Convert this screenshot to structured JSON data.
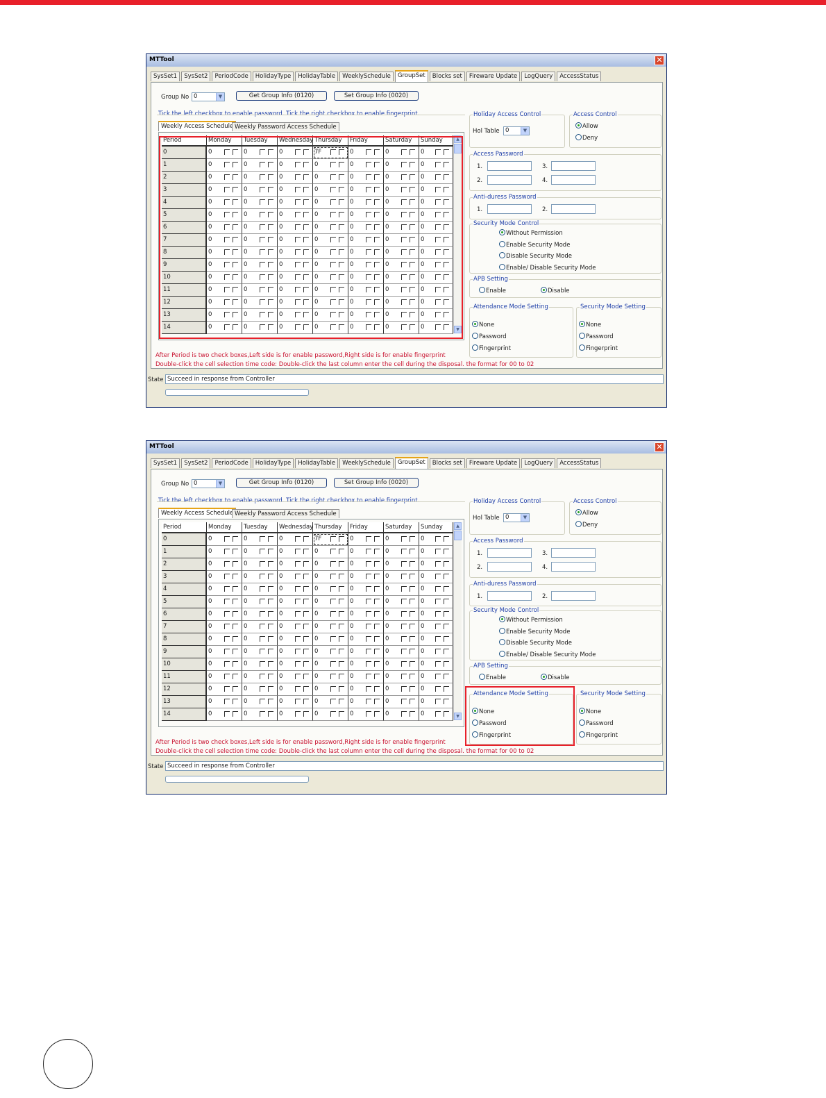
{
  "window": {
    "title": "MTTool",
    "close_label": "✕",
    "tabs": [
      "SysSet1",
      "SysSet2",
      "PeriodCode",
      "HolidayType",
      "HolidayTable",
      "WeeklySchedule",
      "GroupSet",
      "Blocks set",
      "Fireware Update",
      "LogQuery",
      "AccessStatus"
    ],
    "active_tab": 6
  },
  "group": {
    "label": "Group No",
    "value": "0",
    "get_button": "Get Group Info (0120)",
    "set_button": "Set Group Info (0020)"
  },
  "hint_top": "Tick the left checkbox to enable password. Tick the right checkbox to enable fingerprint.",
  "schedule_tabs": [
    "Weekly Access Schedule",
    "Weekly Password Access Schedule"
  ],
  "grid": {
    "columns": [
      "Period",
      "Monday",
      "Tuesday",
      "Wednesday",
      "Thursday",
      "Friday",
      "Saturday",
      "Sunday"
    ],
    "periods": [
      "0",
      "1",
      "2",
      "3",
      "4",
      "5",
      "6",
      "7",
      "8",
      "9",
      "10",
      "11",
      "12",
      "13",
      "14"
    ],
    "cell_value": "0",
    "selected_value": "7F"
  },
  "holiday": {
    "title": "Holiday Access Control",
    "label": "Hol Table",
    "value": "0"
  },
  "access_control": {
    "title": "Access Control",
    "options": [
      "Allow",
      "Deny"
    ]
  },
  "access_password": {
    "title": "Access Password",
    "labels": [
      "1.",
      "2.",
      "3.",
      "4."
    ]
  },
  "anti_duress": {
    "title": "Anti-duress Password",
    "labels": [
      "1.",
      "2."
    ]
  },
  "security_mode": {
    "title": "Security Mode Control",
    "options": [
      "Without Permission",
      "Enable Security Mode",
      "Disable Security Mode",
      "Enable/ Disable Security Mode"
    ]
  },
  "apb": {
    "title": "APB Setting",
    "options": [
      "Enable",
      "Disable"
    ]
  },
  "attendance": {
    "title": "Attendance Mode Setting",
    "options": [
      "None",
      "Password",
      "Fingerprint"
    ]
  },
  "security_setting": {
    "title": "Security Mode Setting",
    "options": [
      "None",
      "Password",
      "Fingerprint"
    ]
  },
  "notes": [
    "After Period is two check boxes,Left side is for enable password,Right side is for enable fingerprint",
    "Double-click the cell selection time code: Double-click the last column enter the cell during the disposal. the format for 00 to 02"
  ],
  "status": {
    "label": "State",
    "text": "Succeed in response from Controller"
  },
  "colors": {
    "highlight": "#e8202a",
    "topbar": "#e8202a"
  }
}
